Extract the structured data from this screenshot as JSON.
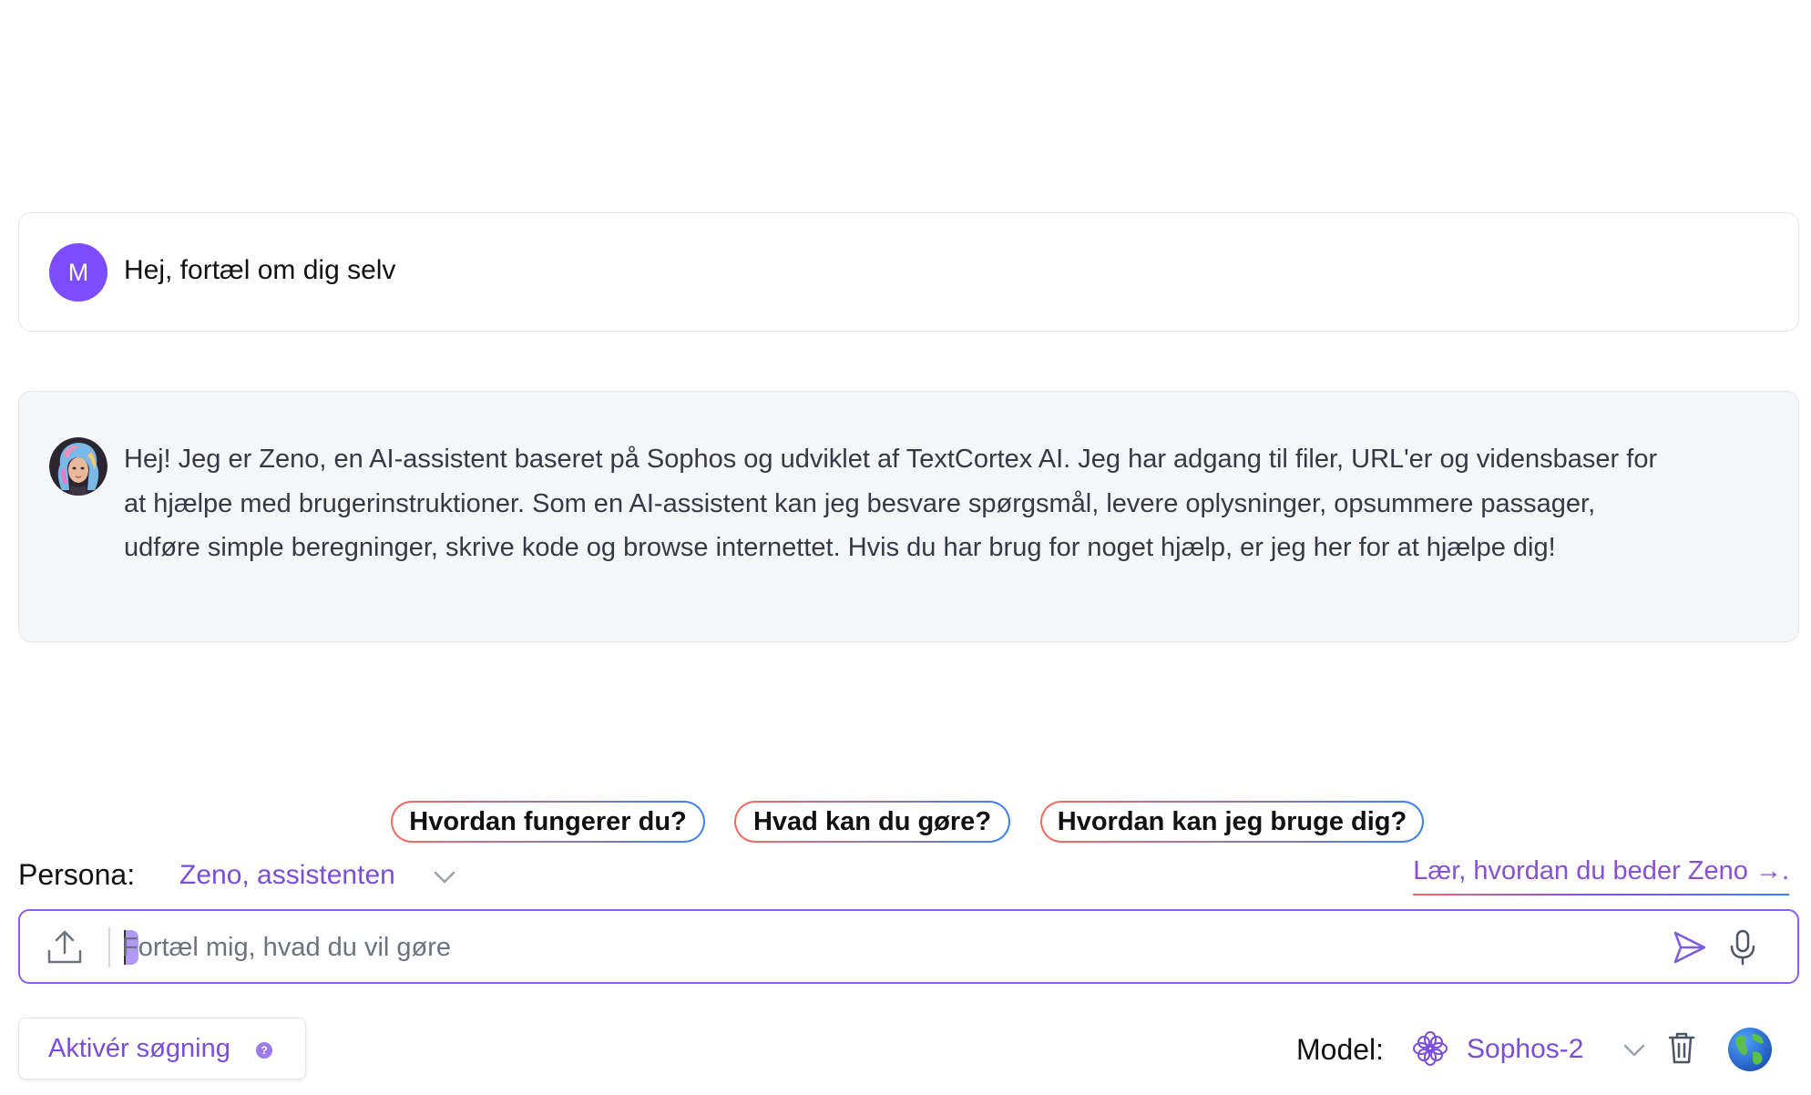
{
  "user_message": {
    "avatar_initial": "M",
    "text": "Hej, fortæl om dig selv"
  },
  "assistant_message": {
    "avatar_icon": "zeno-avatar-icon",
    "text": "Hej! Jeg er Zeno, en AI-assistent baseret på Sophos og udviklet af TextCortex AI. Jeg har adgang til filer, URL'er og vidensbaser for at hjælpe med brugerinstruktioner. Som en AI-assistent kan jeg besvare spørgsmål, levere oplysninger, opsummere passager, udføre simple beregninger, skrive kode og browse internettet. Hvis du har brug for noget hjælp, er jeg her for at hjælpe dig!"
  },
  "suggestions": [
    "Hvordan fungerer du?",
    "Hvad kan du gøre?",
    "Hvordan kan jeg bruge dig?"
  ],
  "persona": {
    "label": "Persona:",
    "value": "Zeno, assistenten"
  },
  "learn_link": "Lær, hvordan du beder Zeno →.",
  "input": {
    "placeholder": "Fortæl mig, hvad du vil gøre",
    "value": ""
  },
  "search_toggle": {
    "label": "Aktivér søgning",
    "help_icon": "question-mark-icon"
  },
  "model": {
    "label": "Model:",
    "value": "Sophos-2",
    "icon": "flower-icon"
  },
  "colors": {
    "accent": "#7b4ddb",
    "input_border": "#8b5cf6",
    "avatar_user": "#7c4dff",
    "chip_gradient_start": "#f26b5b",
    "chip_gradient_end": "#3b82f6",
    "ai_bubble_bg": "#f5f6f8"
  }
}
